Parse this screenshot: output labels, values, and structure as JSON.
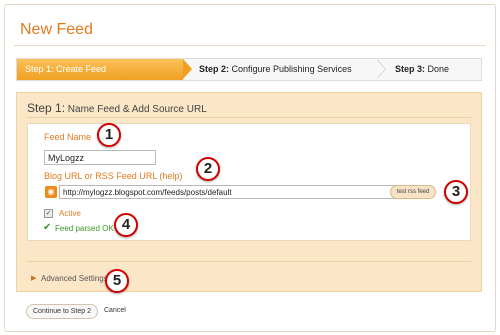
{
  "page": {
    "title": "New Feed"
  },
  "steps": [
    {
      "label": "Step 1: Create Feed",
      "state": "active"
    },
    {
      "prefix": "Step 2:",
      "label": " Configure Publishing Services",
      "state": "pending"
    },
    {
      "prefix": "Step 3:",
      "label": " Done",
      "state": "pending"
    }
  ],
  "section": {
    "number": "Step 1:",
    "title": " Name Feed & Add Source URL"
  },
  "form": {
    "feed_name_label": "Feed Name",
    "feed_name_value": "MyLogzz",
    "url_label": "Blog URL or RSS Feed URL (help)",
    "url_value": "http://mylogzz.blogspot.com/feeds/posts/default",
    "test_button": "test rss feed",
    "active_label": "Active",
    "active_checked": true,
    "status_text": "Feed parsed OK",
    "status_icon": "check-icon"
  },
  "advanced": {
    "label": "Advanced Settings",
    "icon": "triangle-right-icon"
  },
  "actions": {
    "continue_label": "Continue to Step 2",
    "cancel_label": "Cancel"
  },
  "callouts": [
    "1",
    "2",
    "3",
    "4",
    "5"
  ],
  "colors": {
    "accent": "#e07a1f",
    "step_active": "#f0a020",
    "panel": "#fbe6c8",
    "callout_border": "#d10000",
    "ok": "#3a9a2a"
  }
}
